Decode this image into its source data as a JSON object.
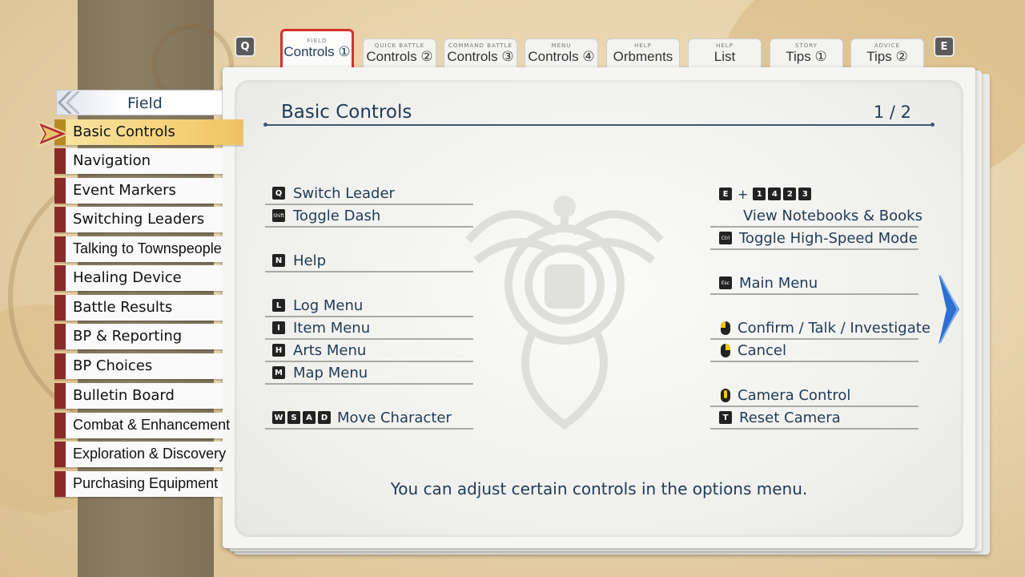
{
  "tabs": {
    "prev_key": "Q",
    "next_key": "E",
    "items": [
      {
        "small": "FIELD",
        "label": "Controls ①",
        "active": true
      },
      {
        "small": "QUICK BATTLE",
        "label": "Controls ②"
      },
      {
        "small": "COMMAND BATTLE",
        "label": "Controls ③"
      },
      {
        "small": "MENU",
        "label": "Controls ④"
      },
      {
        "small": "HELP",
        "label": "Orbments"
      },
      {
        "small": "HELP",
        "label": "List"
      },
      {
        "small": "STORY",
        "label": "Tips ①"
      },
      {
        "small": "ADVICE",
        "label": "Tips ②"
      }
    ]
  },
  "sidebar": {
    "header": "Field",
    "selected_index": 0,
    "items": [
      "Basic Controls",
      "Navigation",
      "Event Markers",
      "Switching Leaders",
      "Talking to Townspeople",
      "Healing Device",
      "Battle Results",
      "BP & Reporting",
      "BP Choices",
      "Bulletin Board",
      "Combat & Enhancement",
      "Exploration & Discovery",
      "Purchasing Equipment"
    ]
  },
  "content": {
    "title": "Basic Controls",
    "page": "1 / 2",
    "left_controls": [
      {
        "keys": [
          "Q"
        ],
        "label": "Switch Leader"
      },
      {
        "keys": [
          "Shift"
        ],
        "label": "Toggle Dash"
      },
      {
        "keys": [
          "N"
        ],
        "label": "Help"
      },
      {
        "keys": [
          "L"
        ],
        "label": "Log Menu"
      },
      {
        "keys": [
          "I"
        ],
        "label": "Item Menu"
      },
      {
        "keys": [
          "H"
        ],
        "label": "Arts Menu"
      },
      {
        "keys": [
          "M"
        ],
        "label": "Map Menu"
      },
      {
        "keys": [
          "W",
          "S",
          "A",
          "D"
        ],
        "label": "Move Character"
      }
    ],
    "right_controls": {
      "combo": {
        "first_key": "E",
        "plus": "+",
        "keys": [
          "1",
          "4",
          "2",
          "3"
        ]
      },
      "combo_label": "View Notebooks & Books",
      "high_speed": {
        "key": "Ctrl",
        "label": "Toggle High-Speed Mode"
      },
      "main_menu": {
        "key": "Esc",
        "label": "Main Menu"
      },
      "confirm": {
        "icon": "mouse-left-icon",
        "label": "Confirm / Talk / Investigate"
      },
      "cancel": {
        "icon": "mouse-right-icon",
        "label": "Cancel"
      },
      "camera": {
        "icon": "mouse-middle-icon",
        "label": "Camera Control"
      },
      "reset": {
        "key": "T",
        "label": "Reset Camera"
      }
    },
    "note": "You can adjust certain controls in the options menu."
  },
  "colors": {
    "accent_red": "#d7312a",
    "text_navy": "#1f3b57",
    "sidebar_marker": "#8a2a28",
    "selected_gold": "#f5cf72",
    "next_arrow_blue": "#2f6fd1"
  }
}
